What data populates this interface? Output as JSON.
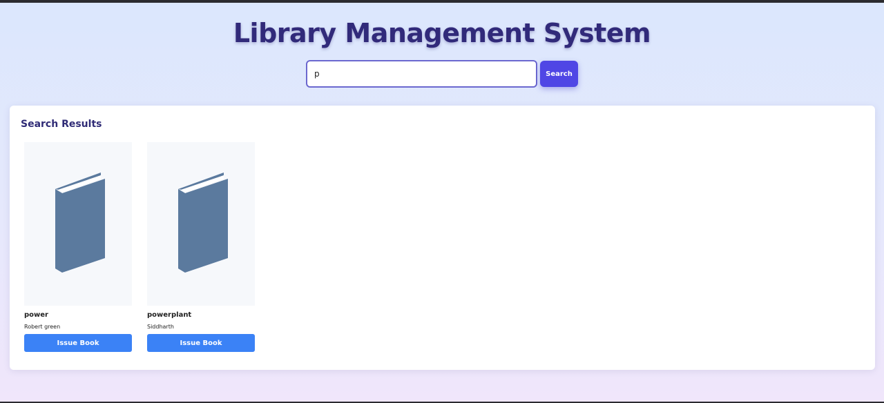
{
  "header": {
    "title": "Library Management System"
  },
  "search": {
    "value": "p",
    "placeholder": "",
    "button_label": "Search"
  },
  "results": {
    "heading": "Search Results",
    "books": [
      {
        "title": "power",
        "author": "Robert green",
        "action_label": "Issue Book",
        "cover_icon": "book-icon"
      },
      {
        "title": "powerplant",
        "author": "Siddharth",
        "action_label": "Issue Book",
        "cover_icon": "book-icon"
      }
    ]
  },
  "colors": {
    "title": "#312a7a",
    "search_button": "#4f46e5",
    "issue_button": "#3b82f6",
    "book_icon": "#5b7a9e",
    "cover_background": "#f6f8fb"
  }
}
